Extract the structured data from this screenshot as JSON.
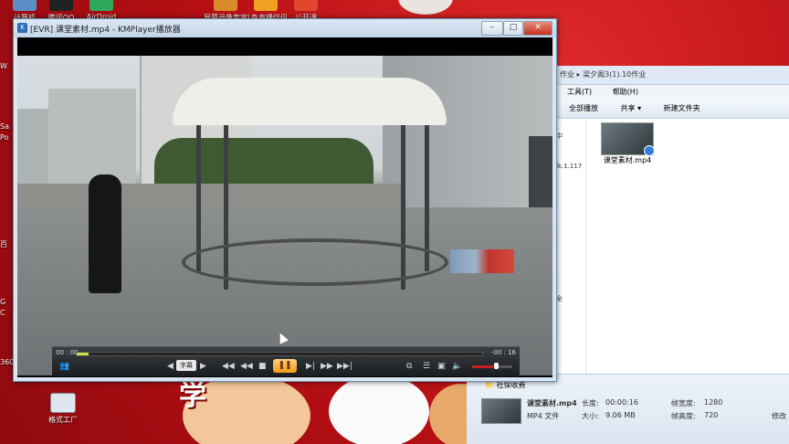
{
  "desktop": {
    "top_icons": [
      {
        "label": "计算机"
      },
      {
        "label": "腾讯QQ"
      },
      {
        "label": "AirDroid"
      },
      {
        "label": "屏幕录像专家"
      },
      {
        "label": "斗鱼直播伴侣"
      },
      {
        "label": "公开课"
      }
    ],
    "left_labels": [
      "W",
      "Sa",
      "Po",
      "百",
      "G",
      "C",
      "360"
    ],
    "bottom_icon": {
      "label": "格式工厂"
    },
    "banner_text": "学"
  },
  "player": {
    "title": "[EVR] 课堂素材.mp4 - KMPlayer播放器",
    "window_buttons": {
      "minimize": "–",
      "maximize": "□",
      "close": "✕"
    },
    "time_elapsed": "00 : 00",
    "time_remaining": "-00 : 16",
    "progress": 0.03,
    "subtitle_label": "字幕",
    "volume": 0.6,
    "controls": {
      "prev_chapter": "◀",
      "next_chapter": "▶",
      "skip_back": "◀◀",
      "rewind": "◀◀",
      "stop": "■",
      "pause": "❚❚",
      "step": "▶|",
      "forward": "▶▶",
      "skip_fwd": "▶▶|",
      "capture": "⧉",
      "playlist": "☰",
      "screen": "▣",
      "volume_icon": "🔈"
    }
  },
  "explorer": {
    "address": "作业 ▸ 梁夕阁3(1).10作业",
    "menu": [
      "工具(T)",
      "帮助(H)"
    ],
    "toolbar": [
      "全部播放",
      "共享 ▾",
      "新建文件夹"
    ],
    "nav_items": [
      "中",
      "lk.1.117",
      "全"
    ],
    "file_name": "课堂素材.mp4",
    "status": {
      "folder": "社保收费",
      "name": "课堂素材.mp4",
      "type": "MP4 文件",
      "length_label": "长度:",
      "length": "00:00:16",
      "size_label": "大小:",
      "size": "9.06 MB",
      "width_label": "帧宽度:",
      "width": "1280",
      "height_label": "帧高度:",
      "height": "720",
      "edit_label": "修改"
    }
  }
}
